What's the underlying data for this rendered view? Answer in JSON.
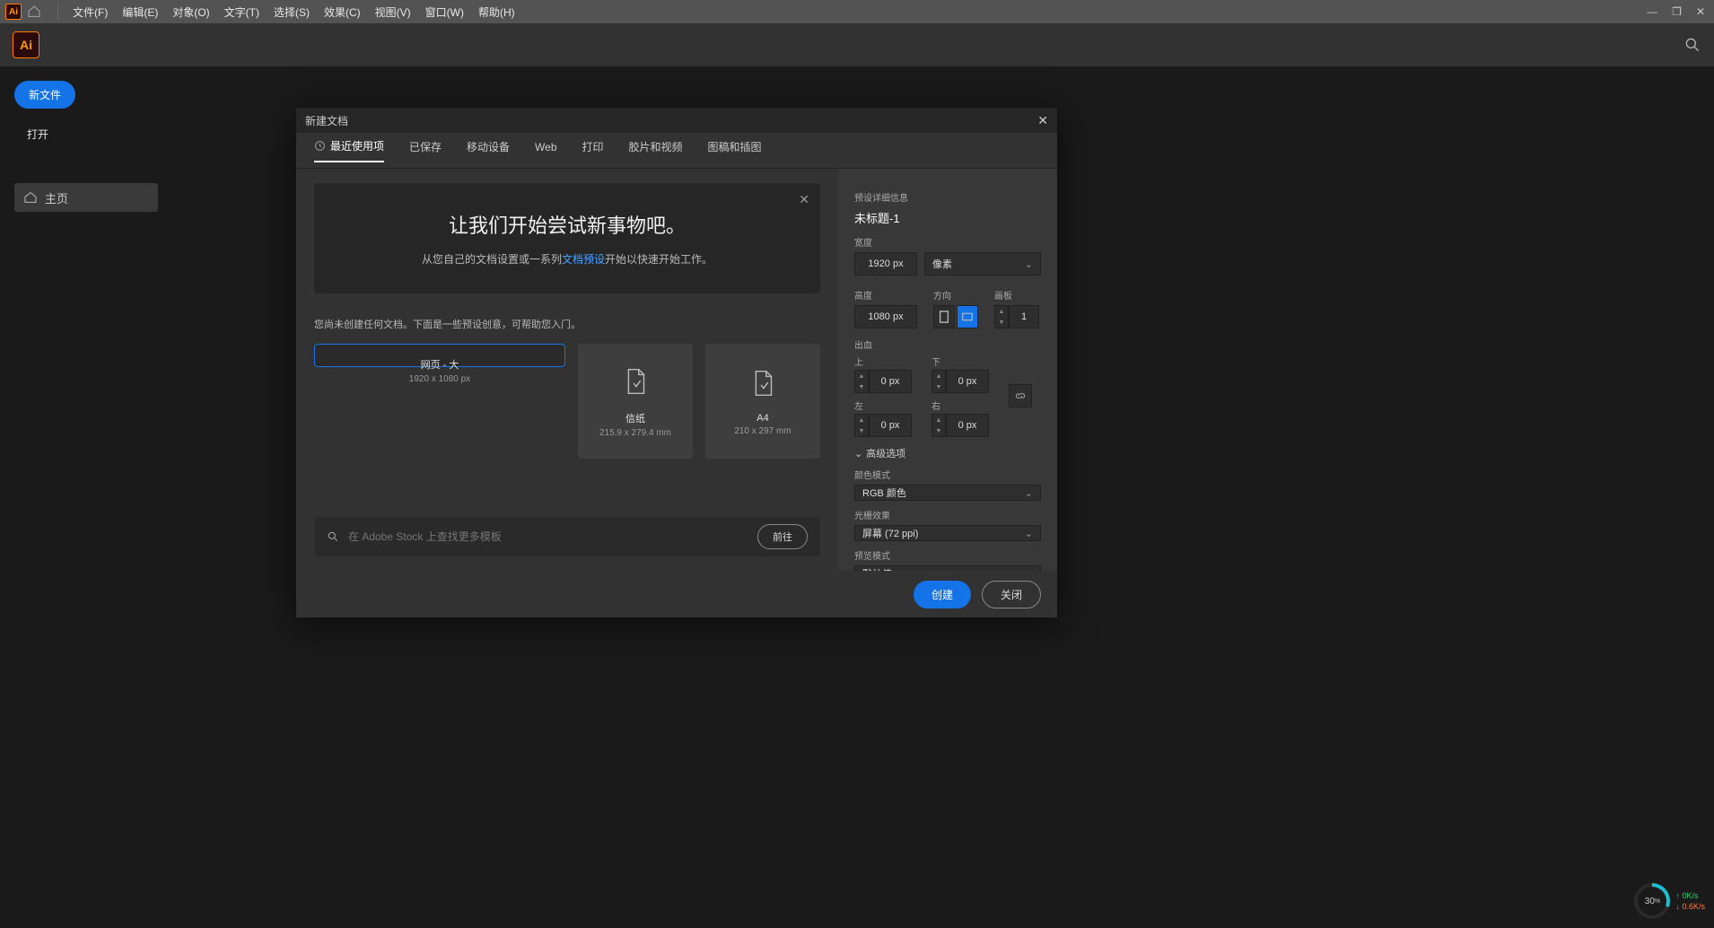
{
  "menubar": {
    "items": [
      "文件(F)",
      "编辑(E)",
      "对象(O)",
      "文字(T)",
      "选择(S)",
      "效果(C)",
      "视图(V)",
      "窗口(W)",
      "帮助(H)"
    ]
  },
  "leftcol": {
    "new_btn": "新文件",
    "open_btn": "打开",
    "home": "主页"
  },
  "dialog": {
    "title": "新建文档",
    "tabs": [
      "最近使用项",
      "已保存",
      "移动设备",
      "Web",
      "打印",
      "胶片和视频",
      "图稿和插图"
    ],
    "banner": {
      "h": "让我们开始尝试新事物吧。",
      "p1": "从您自己的文档设置或一系列",
      "link": "文档预设",
      "p2": "开始以快速开始工作。"
    },
    "sub": "您尚未创建任何文档。下面是一些预设创意，可帮助您入门。",
    "cards": [
      {
        "t": "网页 - 大",
        "s": "1920 x 1080 px"
      },
      {
        "t": "信纸",
        "s": "215.9 x 279.4 mm"
      },
      {
        "t": "A4",
        "s": "210 x 297 mm"
      }
    ],
    "stock_ph": "在 Adobe Stock 上查找更多模板",
    "stock_go": "前往",
    "right": {
      "head": "预设详细信息",
      "name": "未标题-1",
      "width_l": "宽度",
      "width": "1920 px",
      "unit": "像素",
      "height_l": "高度",
      "height": "1080 px",
      "orient_l": "方向",
      "art_l": "画板",
      "art": "1",
      "bleed_l": "出血",
      "top_l": "上",
      "bottom_l": "下",
      "left_l": "左",
      "right_l": "右",
      "bv": "0 px",
      "adv": "高级选项",
      "color_l": "颜色模式",
      "color": "RGB 颜色",
      "raster_l": "光栅效果",
      "raster": "屏幕 (72 ppi)",
      "preview_l": "预览模式",
      "preview": "默认值"
    },
    "create": "创建",
    "close": "关闭"
  },
  "netmon": {
    "pct": "30",
    "unit": "%",
    "up": "0K/s",
    "dn": "0.6K/s"
  }
}
